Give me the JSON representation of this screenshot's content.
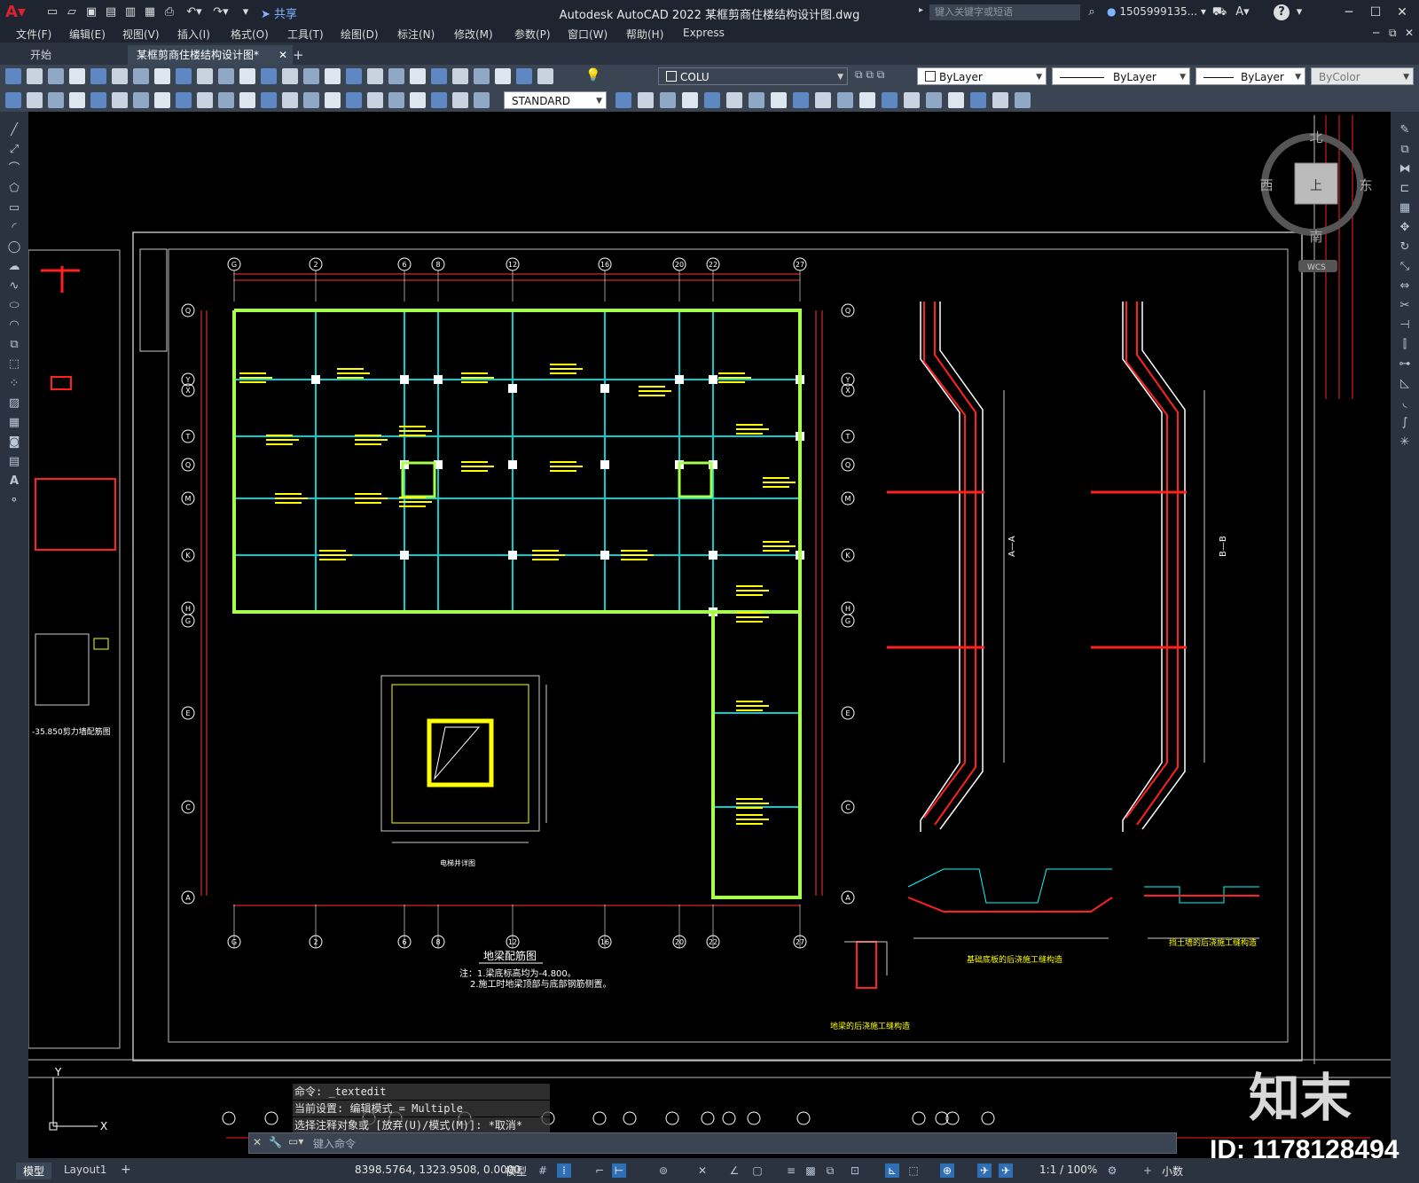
{
  "window": {
    "title": "Autodesk AutoCAD 2022    某框剪商住楼结构设计图.dwg",
    "share_label": "共享",
    "search_placeholder": "键入关键字或短语",
    "user": "1505999135...",
    "help": "?"
  },
  "menu": [
    "文件(F)",
    "编辑(E)",
    "视图(V)",
    "插入(I)",
    "格式(O)",
    "工具(T)",
    "绘图(D)",
    "标注(N)",
    "修改(M)",
    "参数(P)",
    "窗口(W)",
    "帮助(H)",
    "Express"
  ],
  "tabs": [
    {
      "label": "开始",
      "active": false
    },
    {
      "label": "某框剪商住楼结构设计图*",
      "active": true
    }
  ],
  "toolbar": {
    "layer": "COLU",
    "color": "ByLayer",
    "linetype": "ByLayer",
    "lineweight": "ByLayer",
    "plotstyle": "ByColor",
    "textstyle": "STANDARD"
  },
  "viewcube": {
    "north": "北",
    "south": "南",
    "east": "东",
    "west": "西",
    "top": "上",
    "wcs": "WCS"
  },
  "drawing": {
    "plan_title": "地梁配筋图",
    "notes": [
      "注：1.梁底标高均为-4.800。",
      "2.施工时地梁顶部与底部钢筋侧置。"
    ],
    "axis_top": [
      "G",
      "2",
      "6",
      "8",
      "12",
      "16",
      "20",
      "22",
      "27"
    ],
    "axis_side": [
      "Q",
      "Y",
      "X",
      "T",
      "Q",
      "M",
      "K",
      "H",
      "G",
      "E",
      "C",
      "A"
    ],
    "section_a": "A—A",
    "section_b": "B—B",
    "pit_label": "电梯井详图",
    "detail1": "基础底板的后浇施工缝构造",
    "detail2": "挡土墙的后浇施工缝构造",
    "detail3": "地梁的后浇施工缝构造",
    "left_label": "-35.850剪力墙配筋图"
  },
  "command": {
    "history": [
      "命令: _textedit",
      "当前设置: 编辑模式 = Multiple",
      "选择注释对象或 [放弃(U)/模式(M)]: *取消*"
    ],
    "placeholder": "键入命令"
  },
  "status": {
    "model_tab": "模型",
    "layout_tab": "Layout1",
    "add": "+",
    "coords": "8398.5764, 1323.9508, 0.0000",
    "space": "模型",
    "scale": "1:1 / 100%",
    "units": "小数"
  },
  "watermark": {
    "brand": "知末",
    "id": "ID: 1178128494"
  }
}
